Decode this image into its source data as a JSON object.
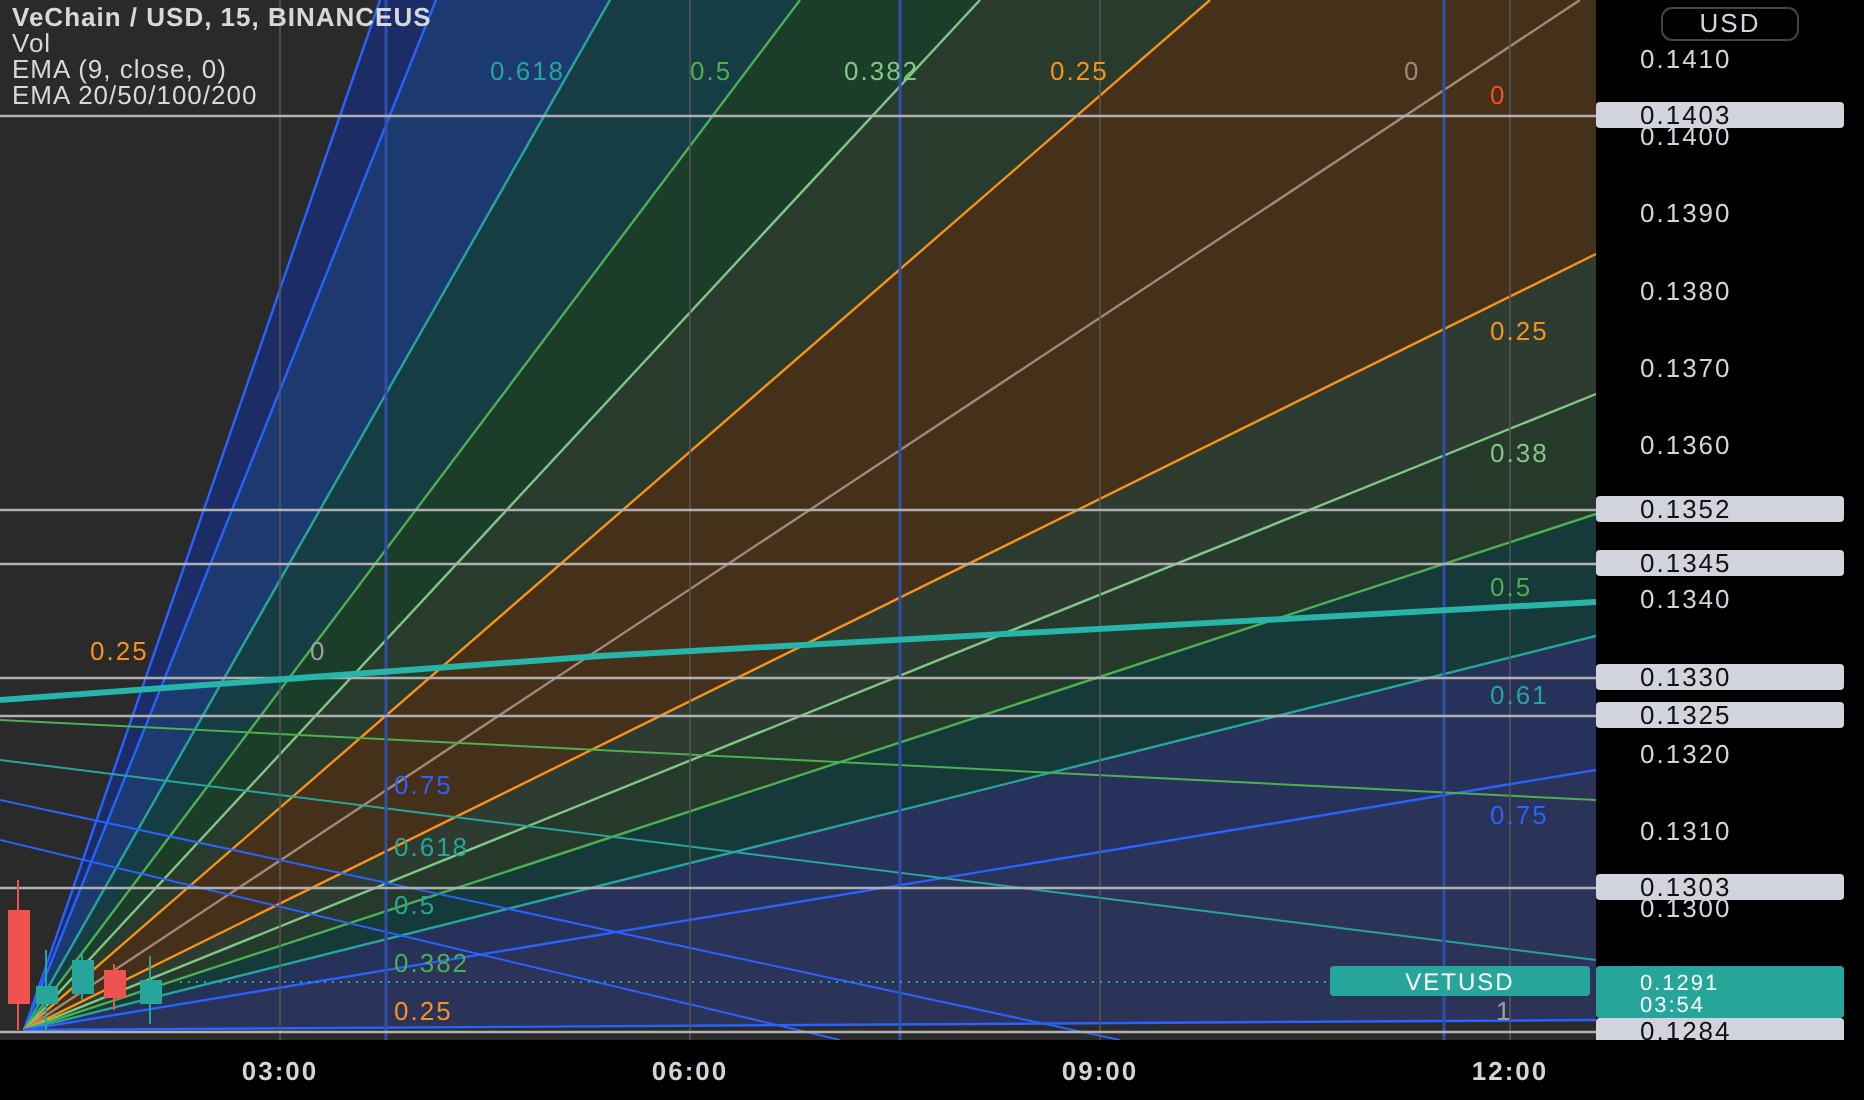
{
  "legend": [
    "VeChain / USD, 15, BINANCEUS",
    "Vol",
    "EMA (9, close, 0)",
    "EMA 20/50/100/200"
  ],
  "currency": "USD",
  "price_ticks": [
    "0.1410",
    "0.1400",
    "0.1390",
    "0.1380",
    "0.1370",
    "0.1360",
    "0.1340",
    "0.1320",
    "0.1310",
    "0.1300"
  ],
  "price_markers": [
    "0.1403",
    "0.1352",
    "0.1345",
    "0.1330",
    "0.1325",
    "0.1303",
    "0.1284"
  ],
  "last_price": {
    "symbol": "VETUSD",
    "price": "0.1291",
    "countdown": "03:54"
  },
  "fan_labels": [
    {
      "text": "0.618",
      "color": "#26a69a"
    },
    {
      "text": "0.5",
      "color": "#4caf50"
    },
    {
      "text": "0.382",
      "color": "#81c784"
    },
    {
      "text": "0.25",
      "color": "#f7931a"
    },
    {
      "text": "0",
      "color": "#a1887f"
    },
    {
      "text": "0",
      "color": "#f4511e"
    },
    {
      "text": "0.25",
      "color": "#f7931a"
    },
    {
      "text": "0.38",
      "color": "#81c784"
    },
    {
      "text": "0.5",
      "color": "#4caf50"
    },
    {
      "text": "0.61",
      "color": "#26a69a"
    },
    {
      "text": "0.75",
      "color": "#2962ff"
    },
    {
      "text": "0.25",
      "color": "#f7931a"
    },
    {
      "text": "0",
      "color": "#9e9e9e"
    },
    {
      "text": "0.75",
      "color": "#2962ff"
    },
    {
      "text": "0.618",
      "color": "#26a69a"
    },
    {
      "text": "0.5",
      "color": "#26a69a"
    },
    {
      "text": "0.382",
      "color": "#4caf50"
    },
    {
      "text": "0.25",
      "color": "#f7931a"
    },
    {
      "text": "1",
      "color": "#9e9e9e"
    }
  ],
  "time_ticks": [
    "03:00",
    "06:00",
    "09:00",
    "12:00"
  ]
}
